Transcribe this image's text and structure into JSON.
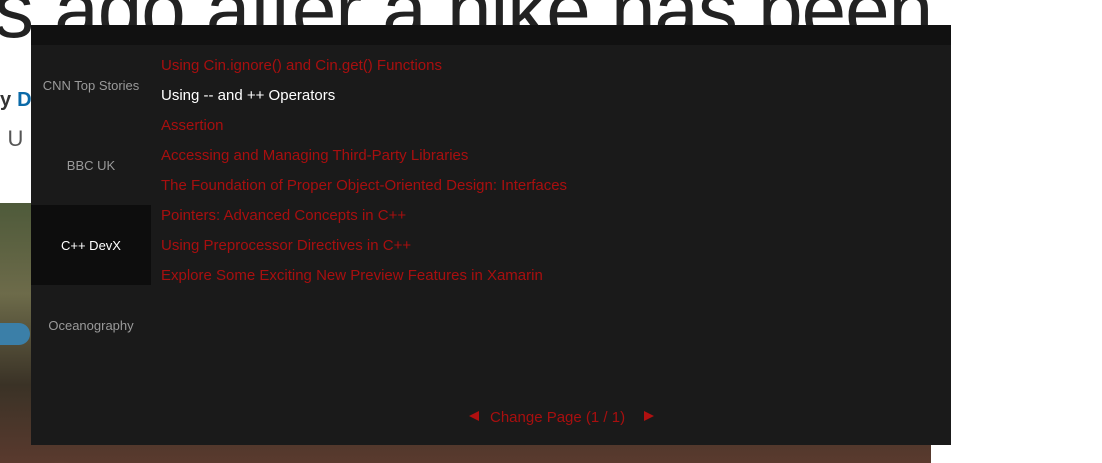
{
  "background": {
    "headline_fragment": "s ago after a hike has been",
    "byline_prefix": "y",
    "byline_author_fragment": "D",
    "subline_fragment": ") U"
  },
  "widget": {
    "sidebar": {
      "items": [
        {
          "label": "CNN Top Stories",
          "active": false
        },
        {
          "label": "BBC UK",
          "active": false
        },
        {
          "label": "C++ DevX",
          "active": true
        },
        {
          "label": "Oceanography",
          "active": false
        }
      ]
    },
    "articles": [
      {
        "title": "Using Cin.ignore() and Cin.get() Functions",
        "selected": false
      },
      {
        "title": "Using -- and ++ Operators",
        "selected": true
      },
      {
        "title": "Assertion",
        "selected": false
      },
      {
        "title": "Accessing and Managing Third-Party Libraries",
        "selected": false
      },
      {
        "title": "The Foundation of Proper Object-Oriented Design: Interfaces",
        "selected": false
      },
      {
        "title": "Pointers: Advanced Concepts in C++",
        "selected": false
      },
      {
        "title": "Using Preprocessor Directives in C++",
        "selected": false
      },
      {
        "title": "Explore Some Exciting New Preview Features in Xamarin",
        "selected": false
      }
    ],
    "pager": {
      "label": "Change Page (1 / 1)",
      "prev_icon": "triangle-left",
      "next_icon": "triangle-right"
    }
  },
  "colors": {
    "widget_bg": "#1a1a1a",
    "link_red": "#a80f0f",
    "selected_text": "#ffffff",
    "active_tab_bg": "#0d0d0d",
    "byline_author_blue": "#0b6aa8"
  }
}
